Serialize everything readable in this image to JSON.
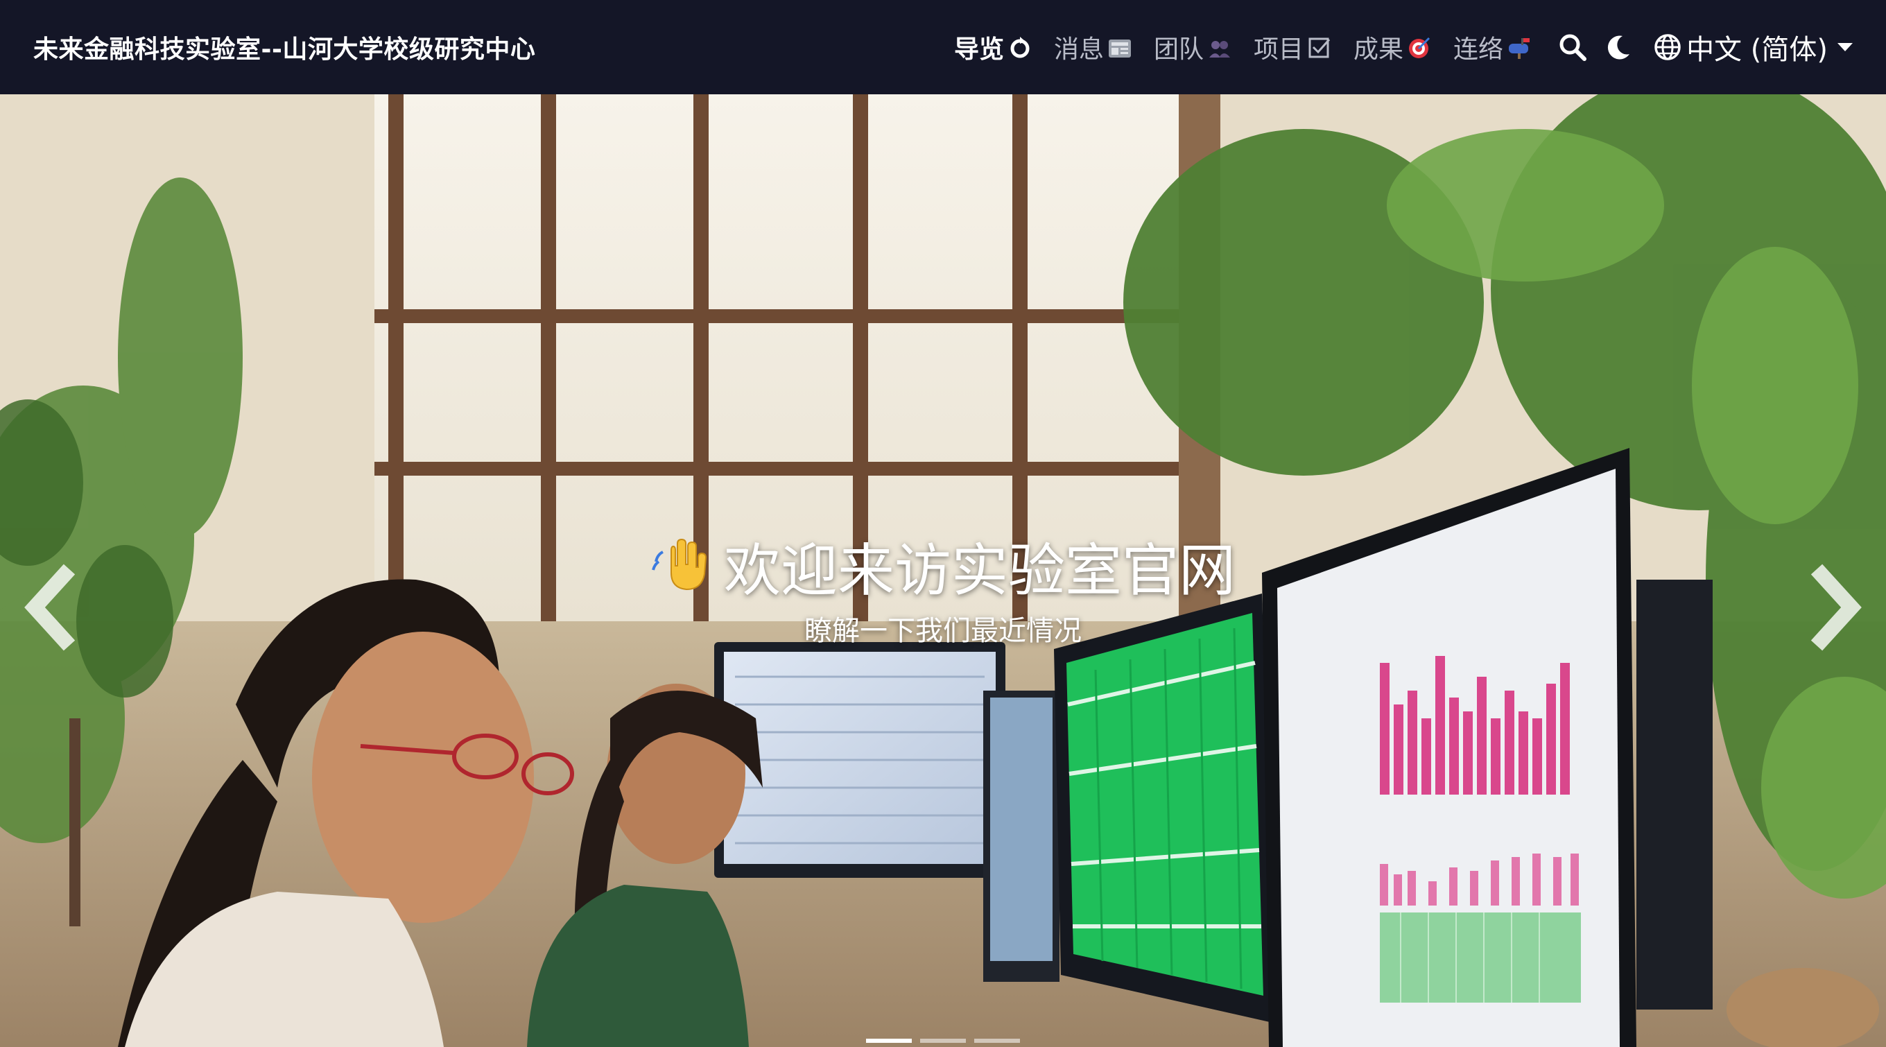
{
  "navbar": {
    "brand": "未来金融科技实验室--山河大学校级研究中心",
    "items": [
      {
        "label": "导览",
        "icon": "recycle-icon",
        "active": true
      },
      {
        "label": "消息",
        "icon": "newspaper-icon"
      },
      {
        "label": "团队",
        "icon": "people-icon"
      },
      {
        "label": "项目",
        "icon": "checkbox-icon"
      },
      {
        "label": "成果",
        "icon": "target-icon"
      },
      {
        "label": "连络",
        "icon": "mailbox-icon"
      }
    ],
    "search_icon": "search-icon",
    "theme_icon": "moon-icon",
    "language": "中文 (简体)"
  },
  "hero": {
    "title": "欢迎来访实验室官网",
    "subtitle": "瞭解一下我们最近情况",
    "wave_icon": "waving-hand-icon",
    "slide_count": 3,
    "active_slide": 0
  },
  "colors": {
    "navbar_bg": "#141627",
    "nav_text": "#b9bcc8",
    "nav_active": "#ffffff"
  }
}
